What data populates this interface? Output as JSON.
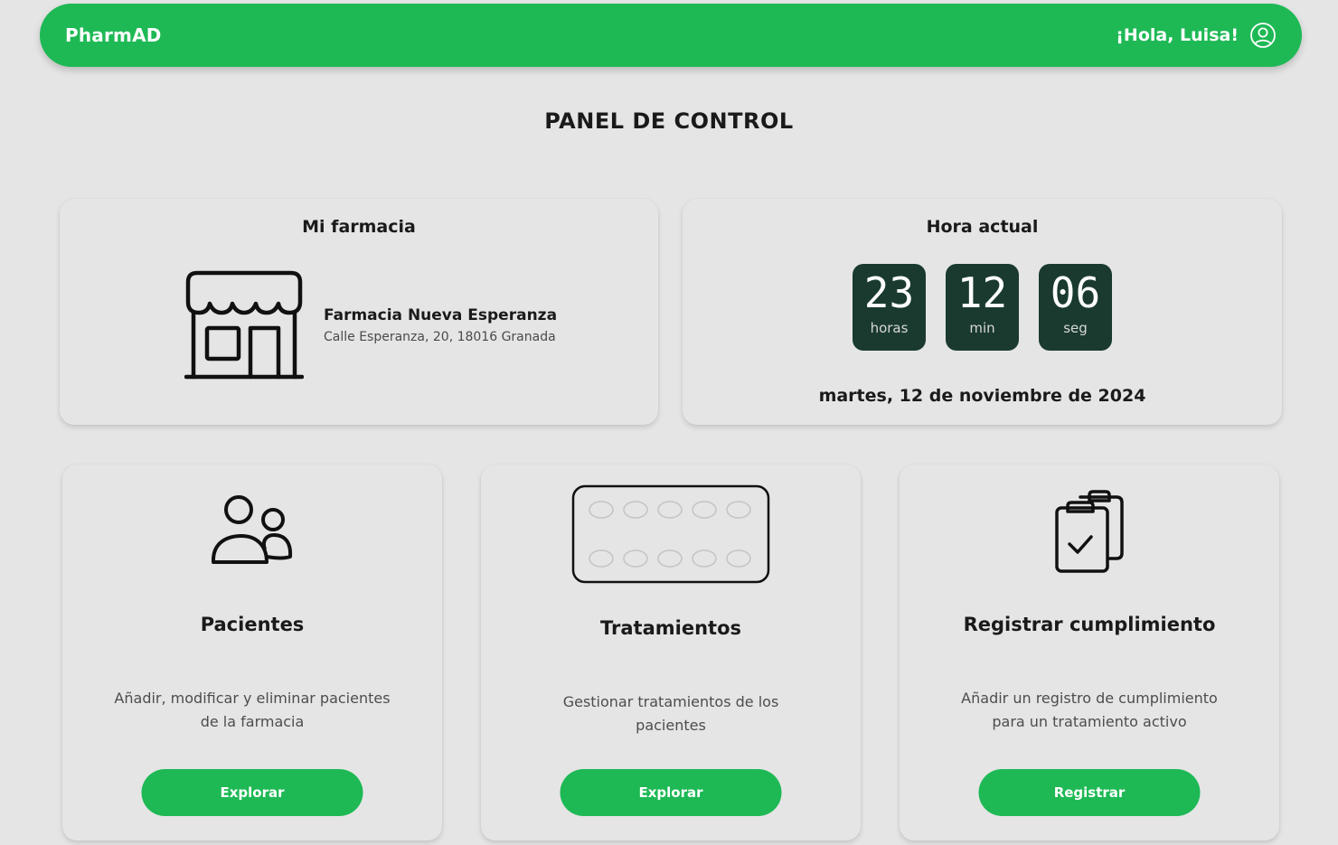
{
  "navbar": {
    "brand": "PharmAD",
    "greeting": "¡Hola, Luisa!",
    "user_icon": "user-circle-icon"
  },
  "page": {
    "title": "PANEL DE CONTROL"
  },
  "pharmacy_card": {
    "title": "Mi farmacia",
    "icon": "store-icon",
    "name": "Farmacia Nueva Esperanza",
    "address": "Calle Esperanza, 20, 18016 Granada"
  },
  "clock_card": {
    "title": "Hora actual",
    "hours": "23",
    "hours_label": "horas",
    "minutes": "12",
    "minutes_label": "min",
    "seconds": "06",
    "seconds_label": "seg",
    "date": "martes, 12 de noviembre de 2024"
  },
  "features": {
    "patients": {
      "icon": "users-icon",
      "title": "Pacientes",
      "description": "Añadir, modificar y eliminar pacientes de la farmacia",
      "button": "Explorar"
    },
    "treatments": {
      "icon": "pill-blister-icon",
      "title": "Tratamientos",
      "description": "Gestionar tratamientos de los pacientes",
      "button": "Explorar"
    },
    "compliance": {
      "icon": "clipboard-check-icon",
      "title": "Registrar cumplimiento",
      "description": "Añadir un registro de cumplimiento para un tratamiento activo",
      "button": "Registrar"
    }
  },
  "colors": {
    "primary": "#1eb955",
    "clock_bg": "#1a3a30",
    "background": "#e5e5e5"
  }
}
